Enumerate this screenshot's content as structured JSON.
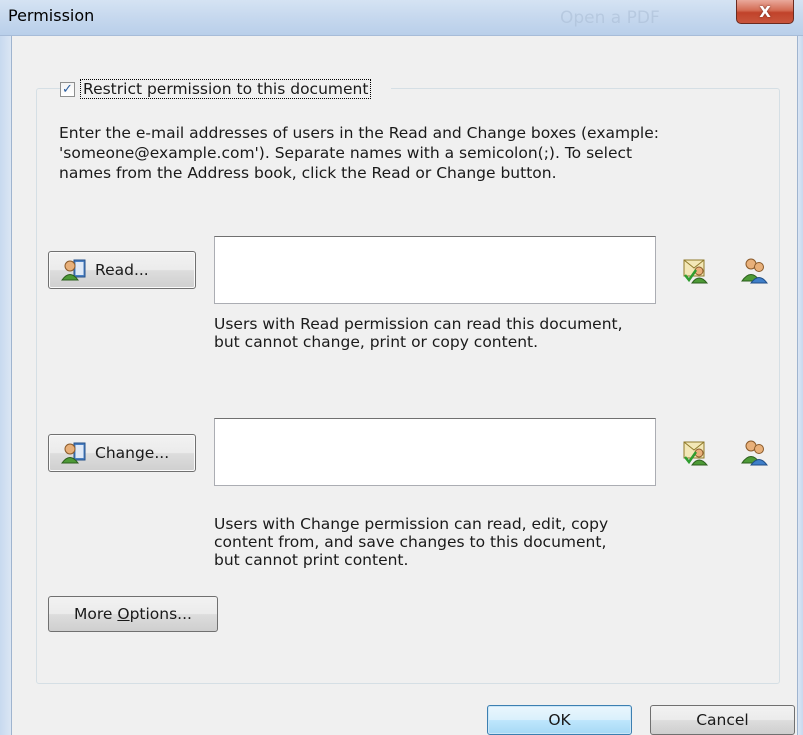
{
  "window": {
    "title": "Permission",
    "background_title": "Open a PDF",
    "close_glyph": "X"
  },
  "restrict": {
    "checked": true,
    "check_glyph": "✓",
    "label": "Restrict permission to this document"
  },
  "instructions": "Enter the e-mail addresses of users in the Read and Change boxes (example:\n'someone@example.com'). Separate names with a semicolon(;). To select\nnames from the Address book, click the Read or Change button.",
  "read": {
    "button_label": "Read...",
    "input_value": "",
    "description": "Users with Read permission can read this document,\nbut cannot change, print or copy content."
  },
  "change": {
    "button_label": "Change...",
    "input_value": "",
    "description": "Users with Change permission can read, edit, copy\ncontent from, and save changes to this document,\nbut cannot print content."
  },
  "more_options": {
    "prefix": "More ",
    "accel": "O",
    "suffix": "ptions..."
  },
  "buttons": {
    "ok": "OK",
    "cancel": "Cancel"
  },
  "icons": {
    "address_book": "address-book-icon",
    "check_names": "check-names-icon",
    "select_users": "select-users-icon"
  },
  "colors": {
    "close_red": "#c9553c",
    "titlebar_blue": "#c6d8ee",
    "ok_border": "#3c7fb1"
  }
}
